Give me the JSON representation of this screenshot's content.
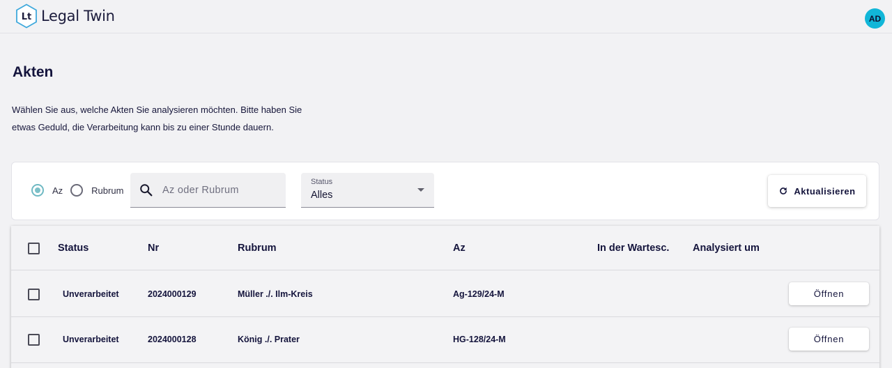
{
  "app": {
    "name": "Legal Twin",
    "logo_letters": "Lt",
    "user_initials": "AD"
  },
  "page": {
    "title": "Akten",
    "intro_line1": "Wählen Sie aus, welche Akten Sie analysieren möchten. Bitte haben Sie",
    "intro_line2": "etwas Geduld, die Verarbeitung kann bis zu einer Stunde dauern."
  },
  "filter": {
    "radio_az": "Az",
    "radio_rubrum": "Rubrum",
    "selected_radio": "Az",
    "search_placeholder": "Az oder Rubrum",
    "status_label": "Status",
    "status_value": "Alles",
    "refresh_label": "Aktualisieren"
  },
  "table": {
    "columns": [
      "Status",
      "Nr",
      "Rubrum",
      "Az",
      "In der Wartesc.",
      "Analysiert um"
    ],
    "rows": [
      {
        "status": "Unverarbeitet",
        "nr": "2024000129",
        "rubrum": "Müller ./. Ilm-Kreis",
        "az": "Ag-129/24-M",
        "queue": "",
        "analyzed": "",
        "action": "Öffnen"
      },
      {
        "status": "Unverarbeitet",
        "nr": "2024000128",
        "rubrum": "König ./. Prater",
        "az": "HG-128/24-M",
        "queue": "",
        "analyzed": "",
        "action": "Öffnen"
      }
    ]
  },
  "colors": {
    "accent": "#11b6d8",
    "text": "#14143c",
    "background": "#f2f2f4",
    "radio_checked": "#7cc0c8"
  },
  "icons": {
    "logo": "hexagon-logo-icon",
    "search": "search-icon",
    "refresh": "refresh-icon",
    "dropdown": "caret-down-icon"
  }
}
